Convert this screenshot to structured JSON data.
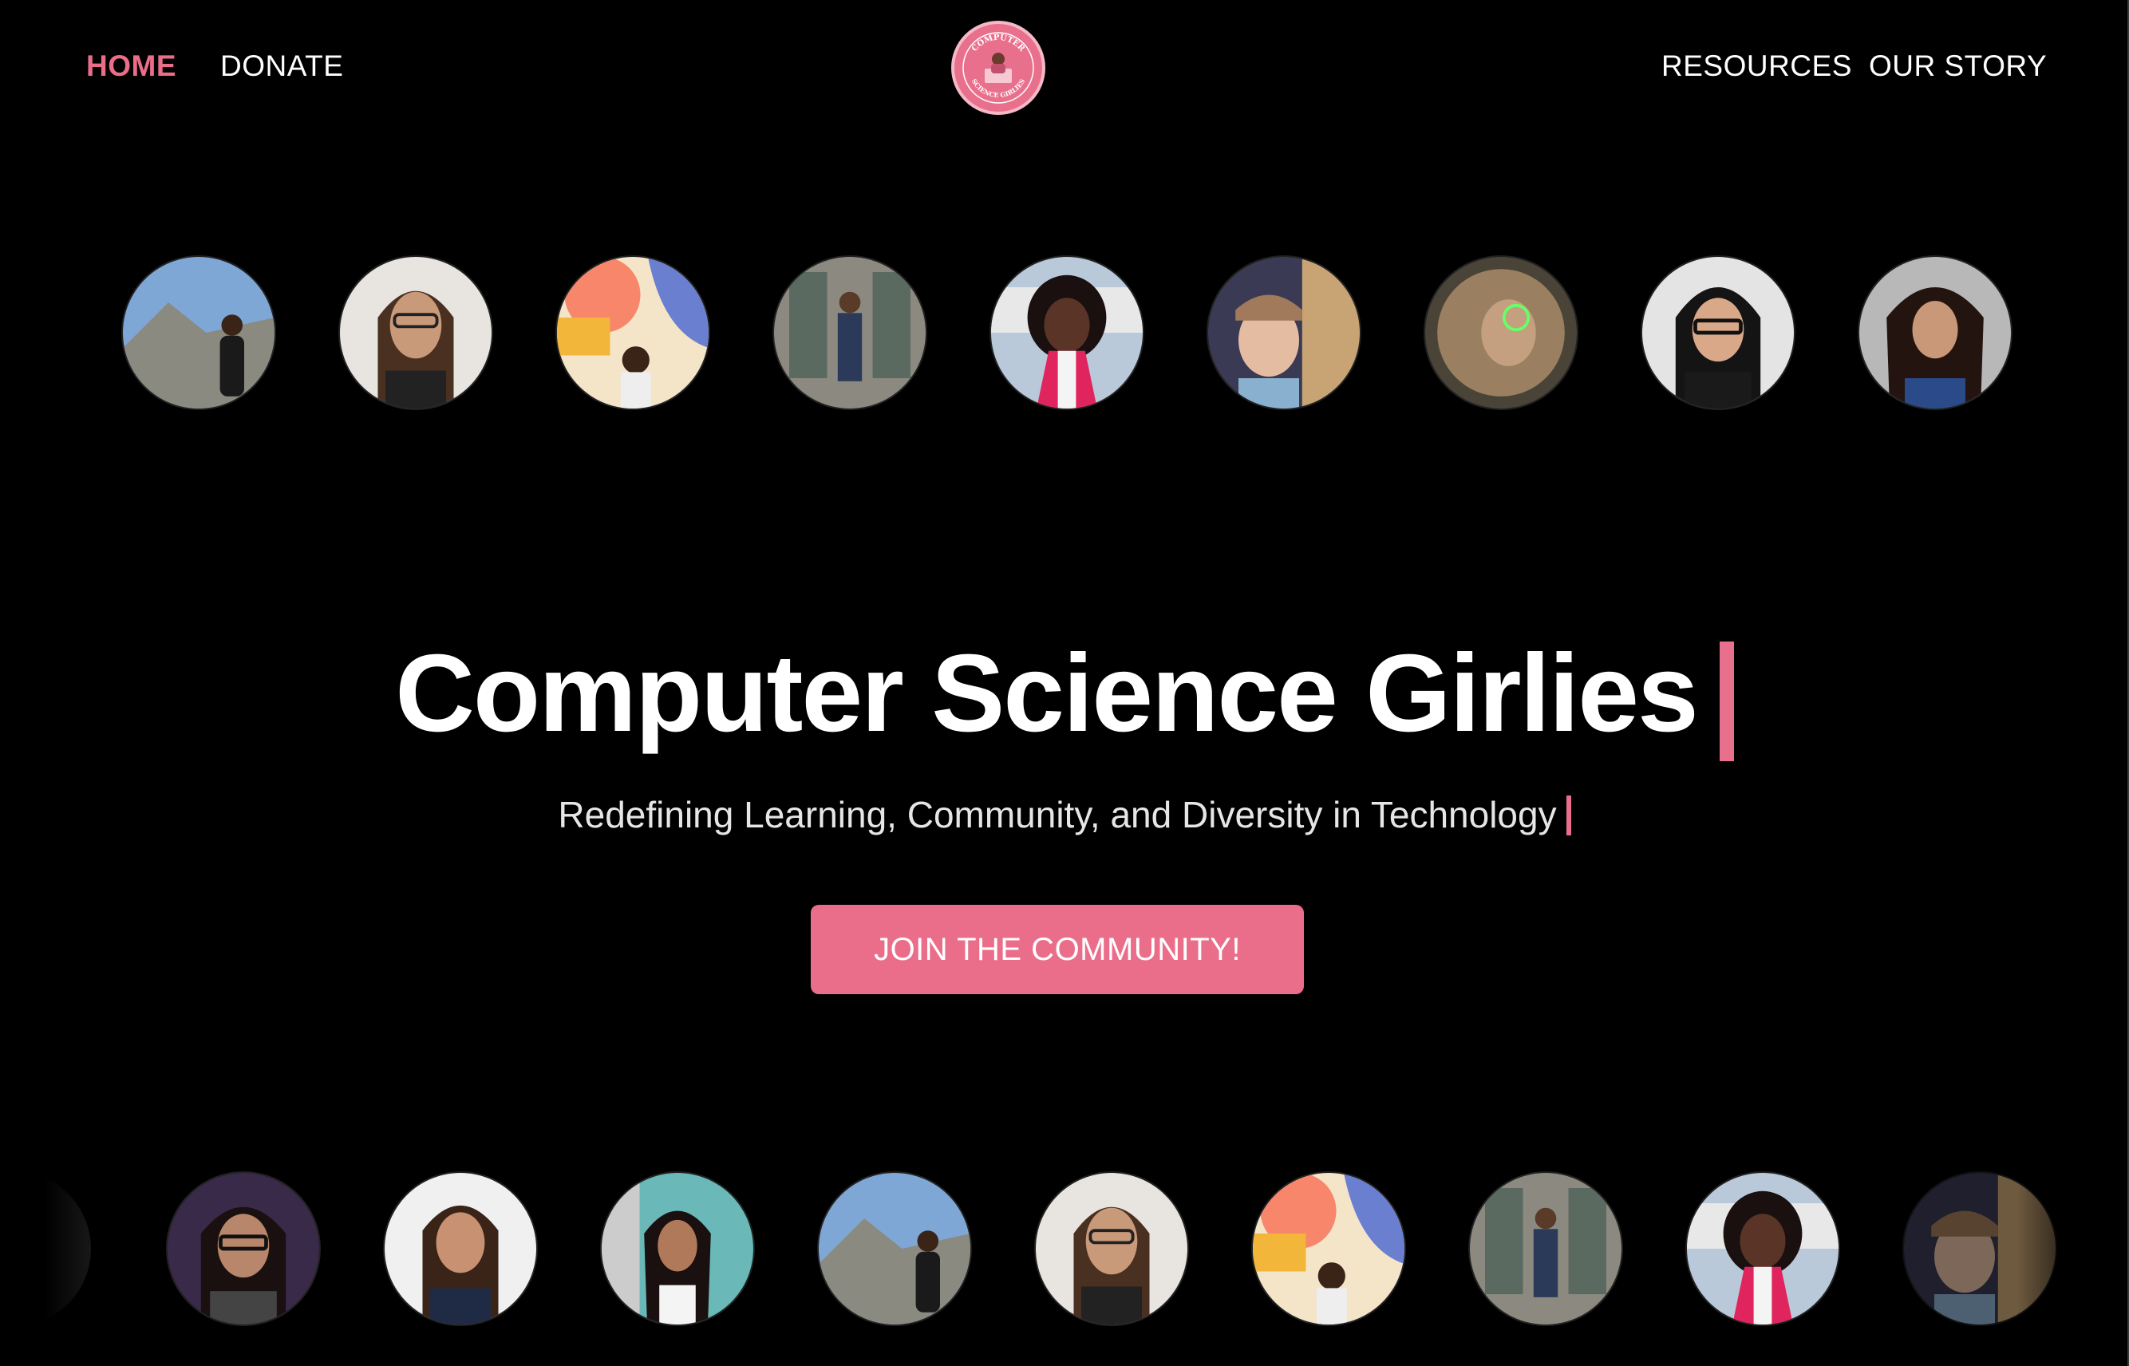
{
  "nav": {
    "left": [
      {
        "label": "HOME",
        "active": true
      },
      {
        "label": "DONATE",
        "active": false
      }
    ],
    "right": [
      {
        "label": "RESOURCES"
      },
      {
        "label": "OUR STORY"
      }
    ],
    "logo": {
      "top_text": "COMPUTER",
      "bottom_text": "SCIENCE GIRLIES"
    }
  },
  "hero": {
    "title": "Computer Science Girlies",
    "subtitle": "Redefining Learning, Community, and Diversity in Technology"
  },
  "cta": {
    "label": "JOIN THE COMMUNITY!"
  },
  "colors": {
    "accent": "#ea6d8a",
    "background": "#000000",
    "text": "#ffffff"
  }
}
